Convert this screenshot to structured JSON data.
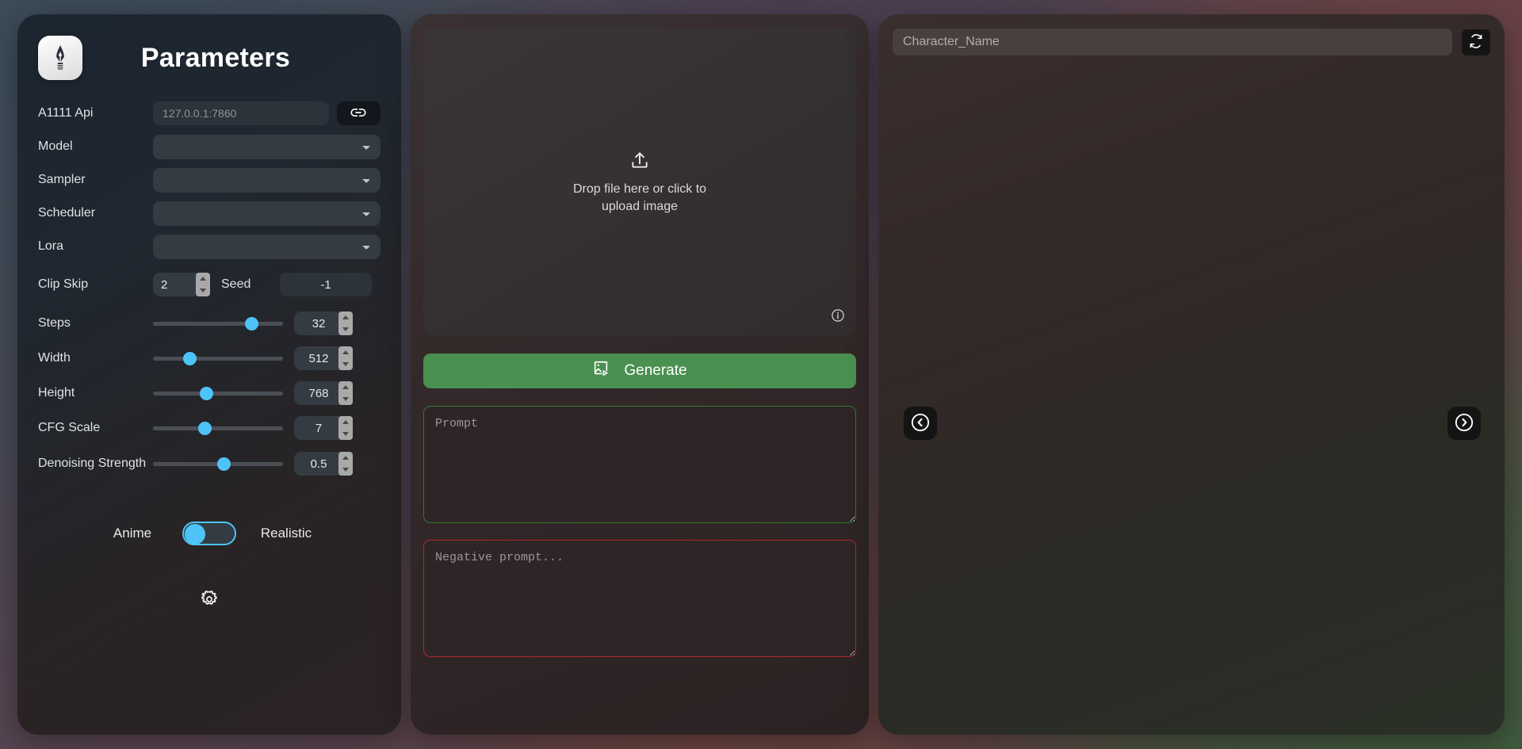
{
  "left_panel": {
    "logo_icon": "pen-nib-icon",
    "title": "Parameters",
    "api": {
      "label": "A1111 Api",
      "placeholder": "127.0.0.1:7860",
      "value": "",
      "link_button_icon": "link-icon"
    },
    "selects": [
      {
        "label": "Model",
        "value": ""
      },
      {
        "label": "Sampler",
        "value": ""
      },
      {
        "label": "Scheduler",
        "value": ""
      },
      {
        "label": "Lora",
        "value": ""
      }
    ],
    "clip_skip": {
      "label": "Clip Skip",
      "value": "2"
    },
    "seed": {
      "label": "Seed",
      "value": "-1"
    },
    "sliders": [
      {
        "label": "Steps",
        "value": "32",
        "percent": 76
      },
      {
        "label": "Width",
        "value": "512",
        "percent": 27
      },
      {
        "label": "Height",
        "value": "768",
        "percent": 38
      },
      {
        "label": "CFG Scale",
        "value": "7",
        "percent": 37
      },
      {
        "label": "Denoising Strength",
        "value": "0.5",
        "percent": 50
      }
    ],
    "style_toggle": {
      "left_label": "Anime",
      "right_label": "Realistic",
      "state": "left",
      "accent": "#4ec3f7"
    },
    "settings_icon": "gear-icon"
  },
  "middle_panel": {
    "dropzone": {
      "upload_icon": "upload-icon",
      "line1": "Drop file here or click to",
      "line2": "upload image",
      "info_icon": "info-icon"
    },
    "generate_button": {
      "label": "Generate",
      "icon": "image-play-icon",
      "color": "#4a9050"
    },
    "prompt": {
      "placeholder": "Prompt",
      "value": "",
      "border_color": "#2f7a31"
    },
    "negative_prompt": {
      "placeholder": "Negative prompt...",
      "value": "",
      "border_color": "#b02a2a"
    }
  },
  "right_panel": {
    "character_input": {
      "placeholder": "Character_Name",
      "value": ""
    },
    "refresh_button_icon": "refresh-icon",
    "prev_button_icon": "circle-chevron-left-icon",
    "next_button_icon": "circle-chevron-right-icon"
  }
}
